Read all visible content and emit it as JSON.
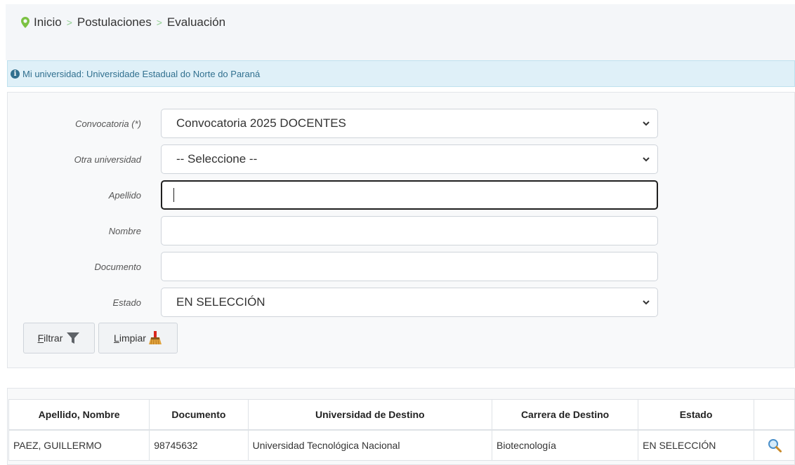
{
  "breadcrumb": {
    "items": [
      "Inicio",
      "Postulaciones",
      "Evaluación"
    ],
    "separator": ">"
  },
  "info": {
    "text": "Mi universidad: Universidade Estadual do Norte do Paraná"
  },
  "filters": {
    "convocatoria": {
      "label": "Convocatoria (*)",
      "value": "Convocatoria 2025 DOCENTES"
    },
    "otra_universidad": {
      "label": "Otra universidad",
      "value": "-- Seleccione --"
    },
    "apellido": {
      "label": "Apellido",
      "value": ""
    },
    "nombre": {
      "label": "Nombre",
      "value": ""
    },
    "documento": {
      "label": "Documento",
      "value": ""
    },
    "estado": {
      "label": "Estado",
      "value": "EN SELECCIÓN"
    }
  },
  "buttons": {
    "filtrar": {
      "accesskey": "F",
      "rest": "iltrar"
    },
    "limpiar": {
      "accesskey": "L",
      "rest": "impiar"
    }
  },
  "table": {
    "columns": [
      "Apellido, Nombre",
      "Documento",
      "Universidad de Destino",
      "Carrera de Destino",
      "Estado",
      ""
    ],
    "rows": [
      {
        "nombre": "PAEZ, GUILLERMO",
        "documento": "98745632",
        "universidad": "Universidad Tecnológica Nacional",
        "carrera": "Biotecnología",
        "estado": "EN SELECCIÓN",
        "action_icon": "magnifier-icon"
      }
    ]
  },
  "colors": {
    "pin": "#7cc243",
    "info_bg": "#dff0f8",
    "info_text": "#31708f",
    "broom": "#d9261c"
  }
}
